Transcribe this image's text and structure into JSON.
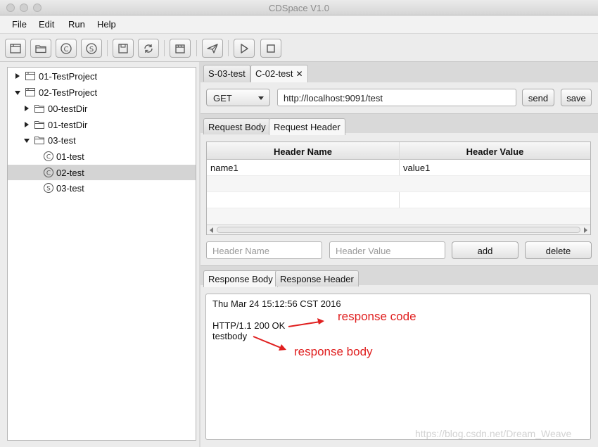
{
  "window": {
    "title": "CDSpace V1.0"
  },
  "menu": {
    "items": [
      "File",
      "Edit",
      "Run",
      "Help"
    ]
  },
  "toolbar": {
    "icons": [
      "new-project-icon",
      "open-folder-icon",
      "client-c-icon",
      "server-s-icon",
      "save-icon",
      "refresh-icon",
      "clapper-icon",
      "send-plane-icon",
      "play-icon",
      "stop-icon"
    ]
  },
  "tree": {
    "items": [
      {
        "label": "01-TestProject",
        "icon": "project-icon",
        "expanded": false
      },
      {
        "label": "02-TestProject",
        "icon": "project-icon",
        "expanded": true
      },
      {
        "label": "00-testDir",
        "icon": "folder-icon",
        "expanded": false
      },
      {
        "label": "01-testDir",
        "icon": "folder-icon",
        "expanded": false
      },
      {
        "label": "03-test",
        "icon": "folder-icon",
        "expanded": true
      },
      {
        "label": "01-test",
        "icon": "client-c-icon"
      },
      {
        "label": "02-test",
        "icon": "client-c-icon",
        "selected": true
      },
      {
        "label": "03-test",
        "icon": "server-s-icon"
      }
    ]
  },
  "editor": {
    "tabs": [
      {
        "label": "S-03-test",
        "active": false
      },
      {
        "label": "C-02-test",
        "active": true,
        "close": "✕"
      }
    ],
    "method": "GET",
    "url": "http://localhost:9091/test",
    "send_label": "send",
    "save_label": "save"
  },
  "request": {
    "tabs": [
      "Request Body",
      "Request Header"
    ],
    "active_tab": "Request Header",
    "table": {
      "columns": [
        "Header Name",
        "Header Value"
      ],
      "rows": [
        [
          "name1",
          "value1"
        ]
      ]
    },
    "header_name_placeholder": "Header Name",
    "header_value_placeholder": "Header Value",
    "add_label": "add",
    "delete_label": "delete"
  },
  "response": {
    "tabs": [
      "Response Body",
      "Response Header"
    ],
    "active_tab": "Response Body",
    "timestamp": "Thu Mar 24 15:12:56 CST 2016",
    "status_line": "HTTP/1.1 200 OK",
    "body": "testbody"
  },
  "annotations": {
    "code": "response code",
    "body": "response body",
    "color": "#e02020"
  },
  "watermark": "https://blog.csdn.net/Dream_Weave"
}
